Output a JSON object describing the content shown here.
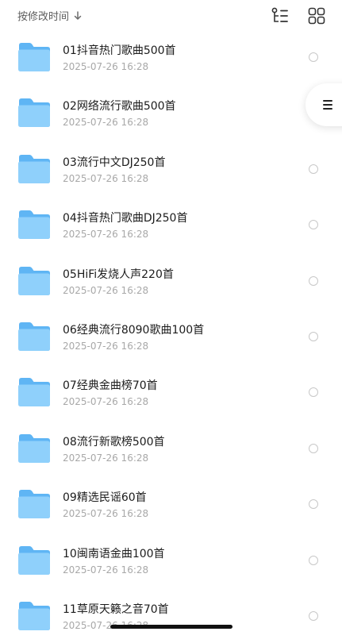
{
  "header": {
    "sort_label": "按修改时间"
  },
  "files": [
    {
      "name": "01抖音热门歌曲500首",
      "date": "2025-07-26 16:28"
    },
    {
      "name": "02网络流行歌曲500首",
      "date": "2025-07-26 16:28"
    },
    {
      "name": "03流行中文DJ250首",
      "date": "2025-07-26 16:28"
    },
    {
      "name": "04抖音热门歌曲DJ250首",
      "date": "2025-07-26 16:28"
    },
    {
      "name": "05HiFi发烧人声220首",
      "date": "2025-07-26 16:28"
    },
    {
      "name": "06经典流行8090歌曲100首",
      "date": "2025-07-26 16:28"
    },
    {
      "name": "07经典金曲榜70首",
      "date": "2025-07-26 16:28"
    },
    {
      "name": "08流行新歌榜500首",
      "date": "2025-07-26 16:28"
    },
    {
      "name": "09精选民谣60首",
      "date": "2025-07-26 16:28"
    },
    {
      "name": "10闽南语金曲100首",
      "date": "2025-07-26 16:28"
    },
    {
      "name": "11草原天籁之音70首",
      "date": "2025-07-26 16:28"
    }
  ],
  "icons": {
    "sort": "arrow-down-icon",
    "tree": "tree-view-icon",
    "grid": "grid-view-icon",
    "folder": "folder-icon",
    "side": "menu-icon"
  },
  "colors": {
    "folder_light": "#8fd0fb",
    "folder_dark": "#5fb5f4",
    "date_text": "#a8a8a8"
  }
}
